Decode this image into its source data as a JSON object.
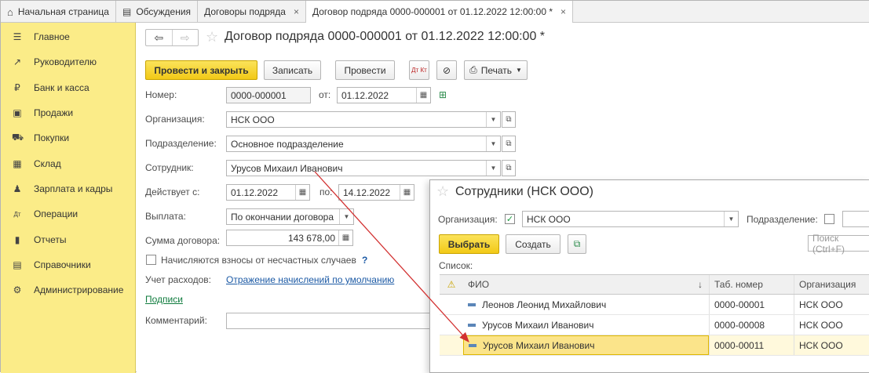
{
  "tabs": [
    {
      "icon": "home-icon",
      "label": "Начальная страница"
    },
    {
      "icon": "chat-icon",
      "label": "Обсуждения"
    },
    {
      "label": "Договоры подряда",
      "close": "×"
    },
    {
      "label": "Договор подряда 0000-000001 от 01.12.2022 12:00:00 *",
      "close": "×"
    }
  ],
  "sidebar": {
    "items": [
      {
        "icon": "☰",
        "label": "Главное"
      },
      {
        "icon": "↗",
        "label": "Руководителю"
      },
      {
        "icon": "₽",
        "label": "Банк и касса"
      },
      {
        "icon": "▣",
        "label": "Продажи"
      },
      {
        "icon": "⛟",
        "label": "Покупки"
      },
      {
        "icon": "▦",
        "label": "Склад"
      },
      {
        "icon": "♟",
        "label": "Зарплата и кадры"
      },
      {
        "icon": "Дт",
        "label": "Операции"
      },
      {
        "icon": "▮",
        "label": "Отчеты"
      },
      {
        "icon": "▤",
        "label": "Справочники"
      },
      {
        "icon": "⚙",
        "label": "Администрирование"
      }
    ]
  },
  "doc": {
    "title": "Договор подряда 0000-000001 от 01.12.2022 12:00:00 *",
    "toolbar": {
      "post_close": "Провести и закрыть",
      "save": "Записать",
      "post": "Провести",
      "dtkt": "Дт Кт",
      "print": "Печать"
    },
    "fields": {
      "number_label": "Номер:",
      "number": "0000-000001",
      "from_label": "от:",
      "date": "01.12.2022",
      "org_label": "Организация:",
      "org": "НСК ООО",
      "dept_label": "Подразделение:",
      "dept": "Основное подразделение",
      "employee_label": "Сотрудник:",
      "employee": "Урусов Михаил Иванович",
      "valid_label": "Действует с:",
      "valid_from": "01.12.2022",
      "to_label": "по:",
      "valid_to": "14.12.2022",
      "payment_label": "Выплата:",
      "payment": "По окончании договора",
      "sum_label": "Сумма договора:",
      "sum": "143 678,00",
      "accident_label": "Начисляются взносы от несчастных случаев",
      "help": "?",
      "expense_label": "Учет расходов:",
      "expense_link": "Отражение начислений по умолчанию",
      "signatures_link": "Подписи",
      "comment_label": "Комментарий:"
    }
  },
  "popup": {
    "title": "Сотрудники (НСК ООО)",
    "org_label": "Организация:",
    "org_checked": "✓",
    "org_value": "НСК ООО",
    "dept_label": "Подразделение:",
    "select_button": "Выбрать",
    "create_button": "Создать",
    "search_placeholder": "Поиск (Ctrl+F)",
    "list_label": "Список:",
    "columns": {
      "warn": "⚠",
      "name": "ФИО",
      "sort": "↓",
      "tab": "Таб. номер",
      "org": "Организация"
    },
    "rows": [
      {
        "name": "Леонов Леонид Михайлович",
        "tab": "0000-00001",
        "org": "НСК ООО"
      },
      {
        "name": "Урусов Михаил Иванович",
        "tab": "0000-00008",
        "org": "НСК ООО"
      },
      {
        "name": "Урусов Михаил Иванович",
        "tab": "0000-00011",
        "org": "НСК ООО"
      }
    ]
  },
  "colors": {
    "sidebar": "#fbec88",
    "primary_button": "#f2c917",
    "arrow": "#d23030",
    "link": "#1c5aa5"
  }
}
